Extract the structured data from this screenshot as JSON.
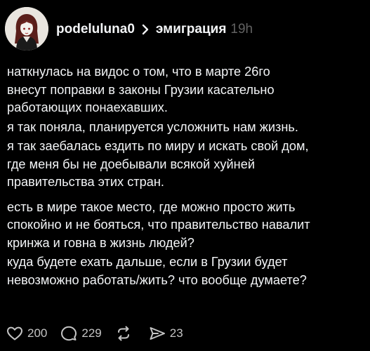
{
  "post": {
    "username": "podelulunа0",
    "topic": "эмиграция",
    "time": "19h",
    "lines_block1": [
      "наткнулась на видос о том, что в марте 26го",
      "внесут поправки в законы Грузии касательно",
      "работающих понаехавших.",
      "я так поняла, планируется усложнить нам жизнь.",
      "я так заебалась ездить по миру и искать свой дом,",
      "где меня бы не доебывали всякой хуйней",
      "правительства этих стран."
    ],
    "lines_block2": [
      "есть в мире такое место, где можно просто жить",
      "спокойно и не бояться, что правительство навалит",
      "кринжа и говна в жизнь людей?",
      "куда будете ехать дальше, если в Грузии будет",
      "невозможно работать/жить? что вообще думаете?"
    ]
  },
  "actions": {
    "likes": "200",
    "comments": "229",
    "shares": "23"
  },
  "icons": {
    "like": "heart-icon",
    "comment": "comment-bubble-icon",
    "repost": "repost-icon",
    "share": "send-icon",
    "separator": "chevron-right-icon"
  }
}
